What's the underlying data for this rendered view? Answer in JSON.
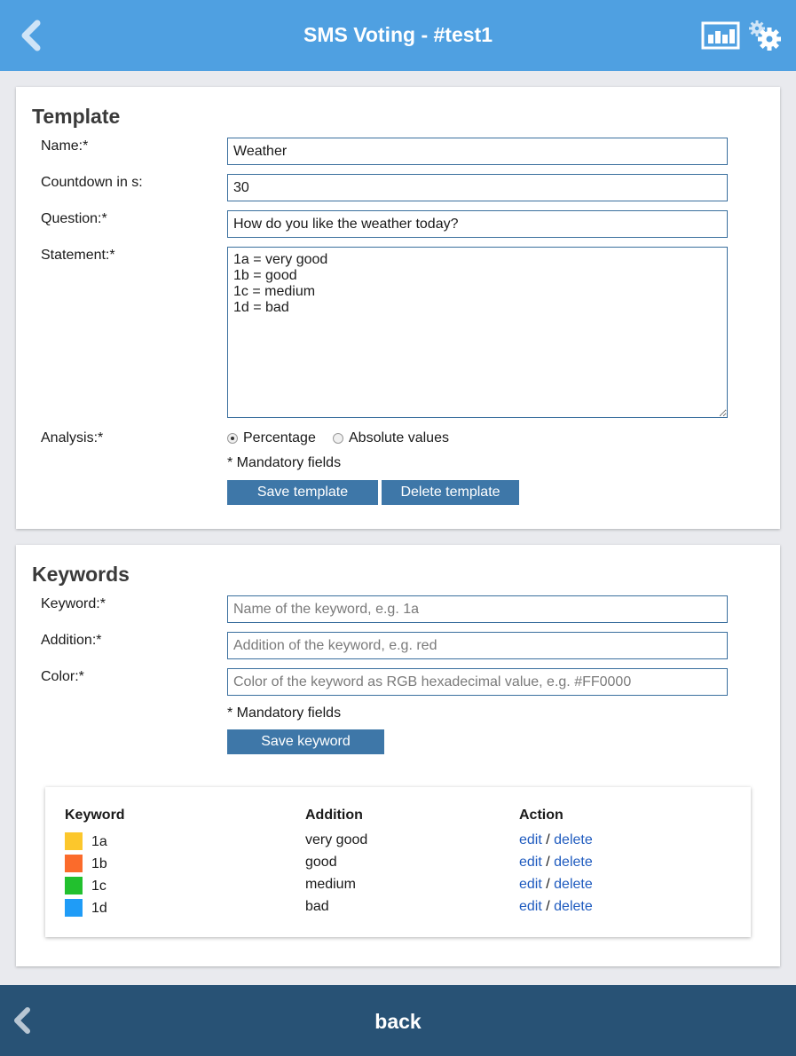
{
  "header": {
    "title": "SMS Voting - #test1",
    "back_icon": "chevron-left-icon",
    "chart_icon": "bar-chart-icon",
    "settings_icon": "gears-icon"
  },
  "template": {
    "heading": "Template",
    "name_label": "Name:*",
    "name_value": "Weather",
    "countdown_label": "Countdown in s:",
    "countdown_value": "30",
    "question_label": "Question:*",
    "question_value": "How do you like the weather today?",
    "statement_label": "Statement:*",
    "statement_value": "1a = very good\n1b = good\n1c = medium\n1d = bad",
    "analysis_label": "Analysis:*",
    "analysis_options": [
      "Percentage",
      "Absolute values"
    ],
    "analysis_selected": "Percentage",
    "mandatory_note": "* Mandatory fields",
    "save_label": "Save template",
    "delete_label": "Delete template"
  },
  "keywords": {
    "heading": "Keywords",
    "keyword_label": "Keyword:*",
    "keyword_placeholder": "Name of the keyword, e.g. 1a",
    "addition_label": "Addition:*",
    "addition_placeholder": "Addition of the keyword, e.g. red",
    "color_label": "Color:*",
    "color_placeholder": "Color of the keyword as RGB hexadecimal value, e.g. #FF0000",
    "mandatory_note": "* Mandatory fields",
    "save_label": "Save keyword",
    "table": {
      "headers": [
        "Keyword",
        "Addition",
        "Action"
      ],
      "edit_label": "edit",
      "separator": "/",
      "delete_label": "delete",
      "rows": [
        {
          "keyword": "1a",
          "addition": "very good",
          "color": "#fcc72c"
        },
        {
          "keyword": "1b",
          "addition": "good",
          "color": "#fb6b2b"
        },
        {
          "keyword": "1c",
          "addition": "medium",
          "color": "#22c02e"
        },
        {
          "keyword": "1d",
          "addition": "bad",
          "color": "#1f9cf7"
        }
      ]
    }
  },
  "footer": {
    "back_label": "back"
  },
  "colors": {
    "header_bg": "#4fa0e1",
    "footer_bg": "#285275",
    "button_bg": "#3e77a8",
    "link": "#1f5bbf"
  }
}
